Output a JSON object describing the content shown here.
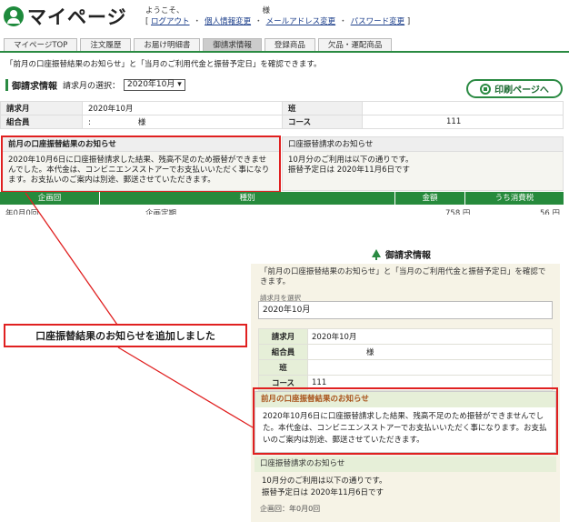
{
  "header": {
    "logo_text": "マイページ",
    "welcome": "ようこそ、",
    "sama": "様",
    "links": [
      "ログアウト",
      "個人情報変更",
      "メールアドレス変更",
      "パスワード変更"
    ]
  },
  "tabs": [
    "マイページTOP",
    "注文履歴",
    "お届け明細書",
    "御請求情報",
    "登録商品",
    "欠品・運配商品"
  ],
  "intro": "「前月の口座振替結果のお知らせ」と「当月のご利用代金と振替予定日」を確認できます。",
  "billing": {
    "title": "御請求情報",
    "month_label": "請求月の選択：",
    "month_value": "2020年10月 ▾",
    "print_button": "印刷ページへ"
  },
  "info_table": {
    "seikyu_label": "請求月",
    "seikyu_value": "2020年10月",
    "han_label": "班",
    "kumiai_label": "組合員",
    "kumiai_colon": ":",
    "kumiai_value": "様",
    "course_label": "コース",
    "course_value": "111"
  },
  "notice_left": {
    "title": "前月の口座振替結果のお知らせ",
    "body": "2020年10月6日に口座振替請求した結果、残高不足のため振替ができませんでした。本代金は、コンビニエンスストアーでお支払いいただく事になります。お支払いのご案内は別途、郵送させていただきます。"
  },
  "notice_right": {
    "title": "口座振替請求のお知らせ",
    "line1": "10月分のご利用は以下の通りです。",
    "line2": "振替予定日は 2020年11月6日です"
  },
  "table_headers": [
    "企画回",
    "種別",
    "金額",
    "うち消費税"
  ],
  "partial_row": [
    "年0月0回",
    "企画定期",
    "758 円",
    "56 円"
  ],
  "mobile": {
    "title": "御請求情報",
    "intro": "「前月の口座振替結果のお知らせ」と「当月のご利用代金と振替予定日」を確認できます。",
    "select_label": "請求月を選択",
    "select_value": "2020年10月",
    "table": [
      {
        "label": "請求月",
        "value": "2020年10月"
      },
      {
        "label": "組合員",
        "value": "様"
      },
      {
        "label": "班",
        "value": ""
      },
      {
        "label": "コース",
        "value": "111"
      }
    ],
    "notice1_title": "前月の口座振替結果のお知らせ",
    "notice1_body": "2020年10月6日に口座振替請求した結果、残高不足のため振替ができませんでした。本代金は、コンビニエンスストアーでお支払いいただく事になります。お支払いのご案内は別途、郵送させていただきます。",
    "notice2_title": "口座振替請求のお知らせ",
    "notice2_line1": "10月分のご利用は以下の通りです。",
    "notice2_line2": "振替予定日は 2020年11月6日です",
    "bottom": "企画回：年0月0回"
  },
  "callout": "口座振替結果のお知らせを追加しました",
  "colors": {
    "brand_green": "#2a8a42",
    "highlight_red": "#e02020",
    "panel_beige": "#f6f3e6"
  }
}
